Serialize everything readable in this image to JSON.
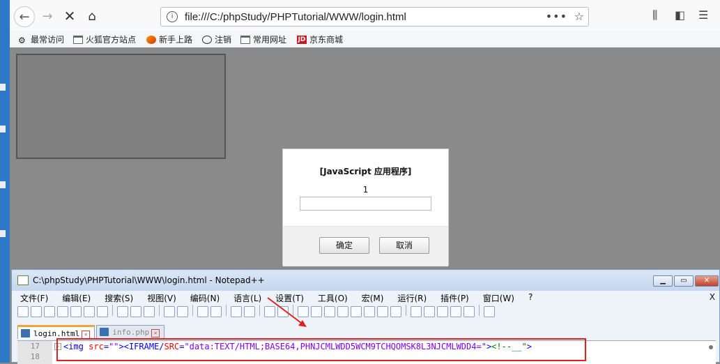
{
  "browser": {
    "url": "file:///C:/phpStudy/PHPTutorial/WWW/login.html",
    "page_actions": "•••",
    "bookmarks": [
      {
        "label": "最常访问",
        "icon": "gear-icon"
      },
      {
        "label": "火狐官方站点",
        "icon": "folder-icon"
      },
      {
        "label": "新手上路",
        "icon": "firefox-icon"
      },
      {
        "label": "注销",
        "icon": "globe-icon"
      },
      {
        "label": "常用网址",
        "icon": "folder-icon"
      },
      {
        "label": "京东商城",
        "icon": "jd-icon",
        "icon_text": "JD"
      }
    ]
  },
  "dialog": {
    "title": "[JavaScript 应用程序]",
    "message": "1",
    "input_value": "",
    "ok_label": "确定",
    "cancel_label": "取消"
  },
  "notepad": {
    "title": "C:\\phpStudy\\PHPTutorial\\WWW\\login.html - Notepad++",
    "menu": [
      "文件(F)",
      "编辑(E)",
      "搜索(S)",
      "视图(V)",
      "编码(N)",
      "语言(L)",
      "设置(T)",
      "工具(O)",
      "宏(M)",
      "运行(R)",
      "插件(P)",
      "窗口(W)",
      "?"
    ],
    "menu_close": "X",
    "tabs": [
      {
        "label": "login.html",
        "active": true
      },
      {
        "label": "info.php",
        "active": false
      }
    ],
    "lines": [
      {
        "number": "17"
      },
      {
        "number": "18"
      }
    ],
    "code": {
      "t1": "<img ",
      "a1": "src",
      "e1": "=",
      "v1": "\"\"",
      "t2": "><IFRAME/",
      "a2": "SRC",
      "e2": "=",
      "v2": "\"data:TEXT/HTML;BASE64,PHNJCMLWDD5WCM9TCHQOMSK8L3NJCMLWDD4=\"",
      "t3": ">",
      "c1": "<!--__\"",
      "t4": ">"
    }
  },
  "colors": {
    "highlight": "#e02020",
    "tag": "#0000ff",
    "attribute": "#ff0000",
    "value": "#8000ff",
    "comment": "#008000"
  }
}
